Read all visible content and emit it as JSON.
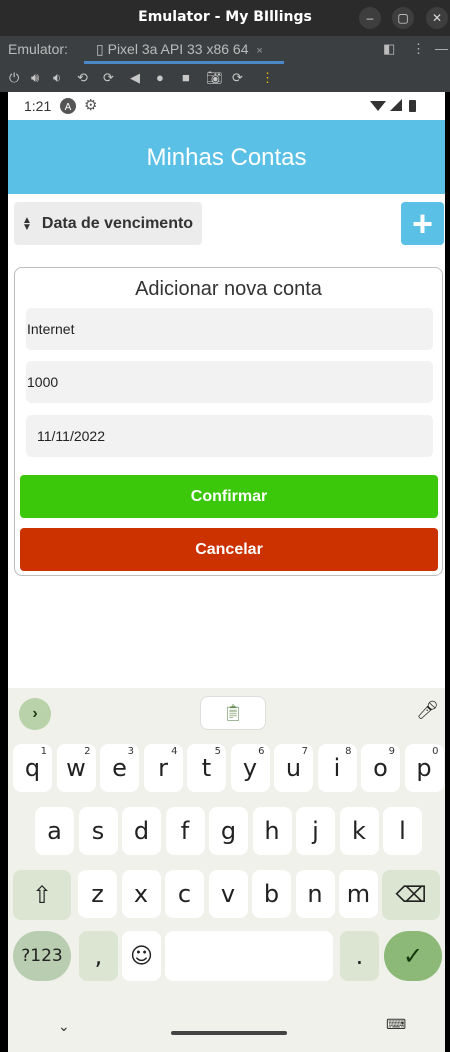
{
  "window": {
    "title": "Emulator - My BIllings",
    "min_icon": "minimize-icon",
    "max_icon": "maximize-icon",
    "close_icon": "close-icon"
  },
  "tabbar": {
    "label": "Emulator:",
    "tab_label": "Pixel 3a API 33 x86 64",
    "tab_close": "×"
  },
  "status": {
    "time": "1:21"
  },
  "app": {
    "title": "Minhas Contas",
    "sort_label": "Data de vencimento",
    "add_label": "+",
    "accent": "#5bc0e6"
  },
  "form": {
    "title": "Adicionar nova conta",
    "name_value": "Internet",
    "amount_value": "1000",
    "date_value": "11/11/2022",
    "confirm_label": "Confirmar",
    "cancel_label": "Cancelar",
    "confirm_color": "#3cc80a",
    "cancel_color": "#cc3100"
  },
  "keyboard": {
    "row1": [
      {
        "k": "q",
        "n": "1"
      },
      {
        "k": "w",
        "n": "2"
      },
      {
        "k": "e",
        "n": "3"
      },
      {
        "k": "r",
        "n": "4"
      },
      {
        "k": "t",
        "n": "5"
      },
      {
        "k": "y",
        "n": "6"
      },
      {
        "k": "u",
        "n": "7"
      },
      {
        "k": "i",
        "n": "8"
      },
      {
        "k": "o",
        "n": "9"
      },
      {
        "k": "p",
        "n": "0"
      }
    ],
    "row2": [
      "a",
      "s",
      "d",
      "f",
      "g",
      "h",
      "j",
      "k",
      "l"
    ],
    "row3": [
      "z",
      "x",
      "c",
      "v",
      "b",
      "n",
      "m"
    ],
    "sym_label": "?123",
    "comma": ",",
    "period": "."
  }
}
